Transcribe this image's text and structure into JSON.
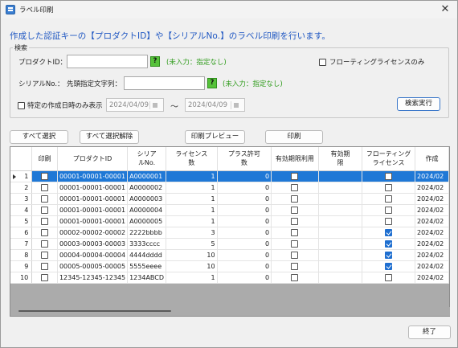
{
  "window": {
    "title": "ラベル印刷",
    "close_glyph": "✕"
  },
  "heading": "作成した認証キーの【プロダクトID】や【シリアルNo.】のラベル印刷を行います。",
  "search": {
    "legend": "検索",
    "product_id_label": "プロダクトID：",
    "product_id_value": "",
    "help_glyph": "?",
    "product_id_note": "(未入力：指定なし)",
    "serial_label": "シリアルNo.：",
    "prefix_label": "先頭指定文字列：",
    "serial_value": "",
    "serial_note": "(未入力：指定なし)",
    "floating_only_label": "フローティングライセンスのみ",
    "date_filter_label": "特定の作成日時のみ表示",
    "date_from": "2024/04/09",
    "date_to": "2024/04/09",
    "tilde": "～",
    "search_button": "検索実行"
  },
  "toolbar": {
    "select_all": "すべて選択",
    "deselect_all": "すべて選択解除",
    "print_preview": "印刷プレビュー",
    "print": "印刷"
  },
  "grid": {
    "columns": [
      "印刷",
      "プロダクトID",
      "シリア\nルNo.",
      "ライセンス\n数",
      "プラス許可\n数",
      "有効期限利用",
      "有効期\n限",
      "フローティング\nライセンス",
      "作成"
    ],
    "rows": [
      {
        "no": "1",
        "print": false,
        "product_id": "00001-00001-00001",
        "serial": "A0000001",
        "licenses": "1",
        "plus": "0",
        "expiry_use": false,
        "expiry": "",
        "floating": false,
        "created": "2024/02",
        "selected": true
      },
      {
        "no": "2",
        "print": false,
        "product_id": "00001-00001-00001",
        "serial": "A0000002",
        "licenses": "1",
        "plus": "0",
        "expiry_use": false,
        "expiry": "",
        "floating": false,
        "created": "2024/02",
        "selected": false
      },
      {
        "no": "3",
        "print": false,
        "product_id": "00001-00001-00001",
        "serial": "A0000003",
        "licenses": "1",
        "plus": "0",
        "expiry_use": false,
        "expiry": "",
        "floating": false,
        "created": "2024/02",
        "selected": false
      },
      {
        "no": "4",
        "print": false,
        "product_id": "00001-00001-00001",
        "serial": "A0000004",
        "licenses": "1",
        "plus": "0",
        "expiry_use": false,
        "expiry": "",
        "floating": false,
        "created": "2024/02",
        "selected": false
      },
      {
        "no": "5",
        "print": false,
        "product_id": "00001-00001-00001",
        "serial": "A0000005",
        "licenses": "1",
        "plus": "0",
        "expiry_use": false,
        "expiry": "",
        "floating": false,
        "created": "2024/02",
        "selected": false
      },
      {
        "no": "6",
        "print": false,
        "product_id": "00002-00002-00002",
        "serial": "2222bbbb",
        "licenses": "3",
        "plus": "0",
        "expiry_use": false,
        "expiry": "",
        "floating": true,
        "created": "2024/02",
        "selected": false
      },
      {
        "no": "7",
        "print": false,
        "product_id": "00003-00003-00003",
        "serial": "3333cccc",
        "licenses": "5",
        "plus": "0",
        "expiry_use": false,
        "expiry": "",
        "floating": true,
        "created": "2024/02",
        "selected": false
      },
      {
        "no": "8",
        "print": false,
        "product_id": "00004-00004-00004",
        "serial": "4444dddd",
        "licenses": "10",
        "plus": "0",
        "expiry_use": false,
        "expiry": "",
        "floating": true,
        "created": "2024/02",
        "selected": false
      },
      {
        "no": "9",
        "print": false,
        "product_id": "00005-00005-00005",
        "serial": "5555eeee",
        "licenses": "10",
        "plus": "0",
        "expiry_use": false,
        "expiry": "",
        "floating": true,
        "created": "2024/02",
        "selected": false
      },
      {
        "no": "10",
        "print": false,
        "product_id": "12345-12345-12345",
        "serial": "1234ABCD",
        "licenses": "1",
        "plus": "0",
        "expiry_use": false,
        "expiry": "",
        "floating": false,
        "created": "2024/02",
        "selected": false
      }
    ]
  },
  "footer": {
    "close_button": "終了"
  },
  "colors": {
    "heading": "#1f57c2",
    "selection": "#1f78d6",
    "note": "#2e9b1a",
    "help_button": "#56c23a"
  }
}
